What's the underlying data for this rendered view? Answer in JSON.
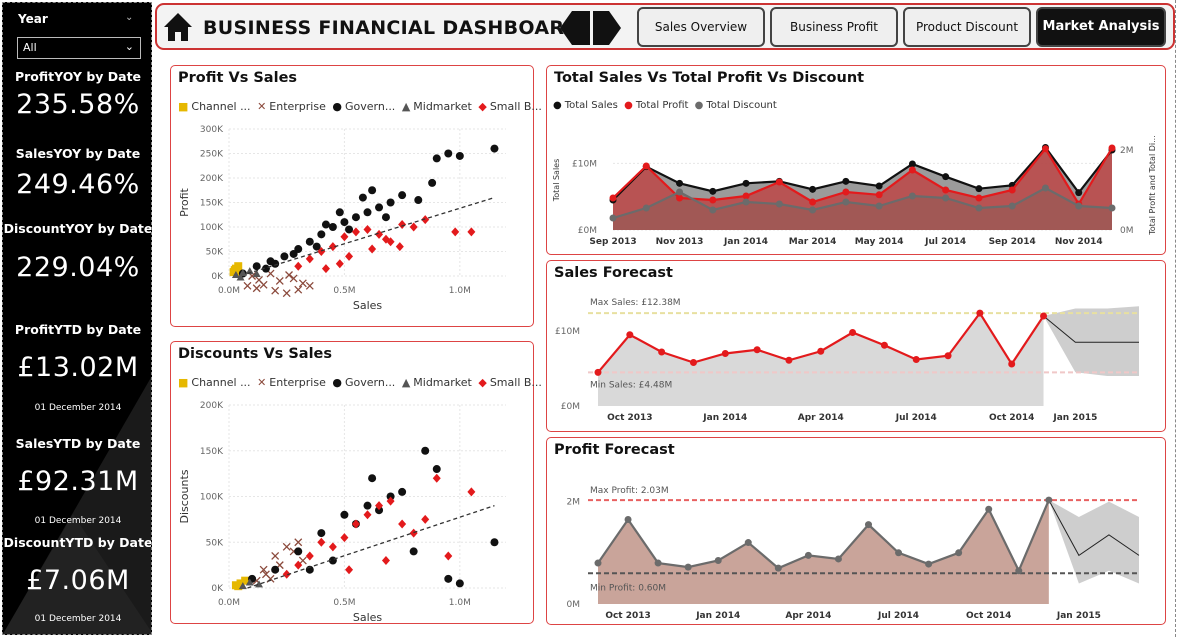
{
  "filter": {
    "label": "Year",
    "value": "All"
  },
  "kpis": [
    {
      "label": "ProfitYOY by Date",
      "value": "235.58%"
    },
    {
      "label": "SalesYOY by Date",
      "value": "249.46%"
    },
    {
      "label": "DiscountYOY by Date",
      "value": "229.04%"
    },
    {
      "label": "ProfitYTD by Date",
      "value": "£13.02M",
      "date": "01 December 2014"
    },
    {
      "label": "SalesYTD by Date",
      "value": "£92.31M",
      "date": "01 December 2014"
    },
    {
      "label": "DiscountYTD by Date",
      "value": "£7.06M",
      "date": "01 December 2014"
    }
  ],
  "header": {
    "title": "BUSINESS FINANCIAL DASHBOARD"
  },
  "tabs": [
    {
      "label": "Sales Overview",
      "active": false
    },
    {
      "label": "Business Profit",
      "active": false
    },
    {
      "label": "Product Discount",
      "active": false
    },
    {
      "label": "Market Analysis",
      "active": true
    }
  ],
  "colors": {
    "red": "#e31a1c",
    "black": "#111111",
    "grey": "#6b6b6b",
    "brown": "#8b4a3c",
    "gold": "#e6b800",
    "panel_border": "#d44444"
  },
  "segments": [
    {
      "name": "Channel ...",
      "marker": "square",
      "color": "#e6b800"
    },
    {
      "name": "Enterprise",
      "marker": "x",
      "color": "#8b4a3c"
    },
    {
      "name": "Govern...",
      "marker": "circle",
      "color": "#111111"
    },
    {
      "name": "Midmarket",
      "marker": "triangle",
      "color": "#555555"
    },
    {
      "name": "Small B...",
      "marker": "diamond",
      "color": "#e31a1c"
    }
  ],
  "chart_data": [
    {
      "type": "scatter",
      "title": "Profit Vs Sales",
      "xlabel": "Sales",
      "ylabel": "Profit",
      "xticks": [
        "0.0M",
        "0.5M",
        "1.0M"
      ],
      "yticks": [
        "0K",
        "50K",
        "100K",
        "150K",
        "200K",
        "250K",
        "300K"
      ],
      "xlim": [
        0,
        1200000
      ],
      "ylim": [
        0,
        300000
      ],
      "trend": [
        [
          80000,
          5000
        ],
        [
          1150000,
          160000
        ]
      ],
      "series": [
        {
          "name": "Channel ...",
          "points": [
            [
              20000,
              8000
            ],
            [
              30000,
              15000
            ],
            [
              40000,
              20000
            ],
            [
              25000,
              12000
            ],
            [
              35000,
              6000
            ]
          ]
        },
        {
          "name": "Enterprise",
          "points": [
            [
              80000,
              -20000
            ],
            [
              120000,
              -25000
            ],
            [
              150000,
              -18000
            ],
            [
              200000,
              -30000
            ],
            [
              250000,
              -35000
            ],
            [
              300000,
              -28000
            ],
            [
              180000,
              5000
            ],
            [
              220000,
              -10000
            ],
            [
              280000,
              -5000
            ],
            [
              320000,
              -15000
            ],
            [
              130000,
              -8000
            ],
            [
              260000,
              2000
            ],
            [
              350000,
              -20000
            ],
            [
              100000,
              0
            ]
          ]
        },
        {
          "name": "Govern...",
          "points": [
            [
              60000,
              5000
            ],
            [
              120000,
              20000
            ],
            [
              180000,
              30000
            ],
            [
              240000,
              40000
            ],
            [
              300000,
              55000
            ],
            [
              350000,
              70000
            ],
            [
              400000,
              85000
            ],
            [
              450000,
              100000
            ],
            [
              500000,
              110000
            ],
            [
              550000,
              120000
            ],
            [
              600000,
              130000
            ],
            [
              650000,
              140000
            ],
            [
              700000,
              150000
            ],
            [
              750000,
              165000
            ],
            [
              580000,
              160000
            ],
            [
              620000,
              175000
            ],
            [
              520000,
              95000
            ],
            [
              480000,
              130000
            ],
            [
              680000,
              120000
            ],
            [
              420000,
              105000
            ],
            [
              380000,
              60000
            ],
            [
              280000,
              45000
            ],
            [
              200000,
              25000
            ],
            [
              160000,
              15000
            ],
            [
              900000,
              240000
            ],
            [
              950000,
              250000
            ],
            [
              1000000,
              245000
            ],
            [
              1150000,
              260000
            ],
            [
              880000,
              190000
            ],
            [
              820000,
              155000
            ]
          ]
        },
        {
          "name": "Midmarket",
          "points": [
            [
              30000,
              2000
            ],
            [
              60000,
              6000
            ],
            [
              90000,
              10000
            ],
            [
              50000,
              -3000
            ],
            [
              120000,
              4000
            ]
          ]
        },
        {
          "name": "Small B...",
          "points": [
            [
              300000,
              20000
            ],
            [
              350000,
              35000
            ],
            [
              400000,
              50000
            ],
            [
              450000,
              60000
            ],
            [
              500000,
              80000
            ],
            [
              550000,
              90000
            ],
            [
              600000,
              95000
            ],
            [
              650000,
              85000
            ],
            [
              700000,
              70000
            ],
            [
              750000,
              105000
            ],
            [
              800000,
              100000
            ],
            [
              850000,
              115000
            ],
            [
              980000,
              90000
            ],
            [
              1050000,
              90000
            ],
            [
              420000,
              15000
            ],
            [
              520000,
              40000
            ],
            [
              620000,
              55000
            ],
            [
              680000,
              75000
            ],
            [
              740000,
              60000
            ],
            [
              480000,
              25000
            ]
          ]
        }
      ]
    },
    {
      "type": "scatter",
      "title": "Discounts Vs Sales",
      "xlabel": "Sales",
      "ylabel": "Discounts",
      "xticks": [
        "0.0M",
        "0.5M",
        "1.0M"
      ],
      "yticks": [
        "0K",
        "50K",
        "100K",
        "150K",
        "200K"
      ],
      "xlim": [
        0,
        1200000
      ],
      "ylim": [
        0,
        200000
      ],
      "trend": [
        [
          80000,
          0
        ],
        [
          1150000,
          90000
        ]
      ],
      "series": [
        {
          "name": "Channel ...",
          "points": [
            [
              30000,
              3000
            ],
            [
              50000,
              5000
            ],
            [
              70000,
              8000
            ],
            [
              40000,
              2000
            ]
          ]
        },
        {
          "name": "Enterprise",
          "points": [
            [
              150000,
              20000
            ],
            [
              200000,
              35000
            ],
            [
              250000,
              45000
            ],
            [
              300000,
              50000
            ],
            [
              180000,
              10000
            ],
            [
              220000,
              25000
            ],
            [
              120000,
              8000
            ],
            [
              280000,
              40000
            ],
            [
              320000,
              30000
            ],
            [
              160000,
              15000
            ]
          ]
        },
        {
          "name": "Govern...",
          "points": [
            [
              100000,
              10000
            ],
            [
              200000,
              20000
            ],
            [
              300000,
              40000
            ],
            [
              400000,
              60000
            ],
            [
              500000,
              80000
            ],
            [
              600000,
              90000
            ],
            [
              700000,
              100000
            ],
            [
              850000,
              150000
            ],
            [
              900000,
              130000
            ],
            [
              1150000,
              50000
            ],
            [
              950000,
              10000
            ],
            [
              800000,
              40000
            ],
            [
              550000,
              70000
            ],
            [
              650000,
              85000
            ],
            [
              450000,
              30000
            ],
            [
              350000,
              20000
            ],
            [
              750000,
              105000
            ],
            [
              1000000,
              5000
            ],
            [
              620000,
              120000
            ]
          ]
        },
        {
          "name": "Midmarket",
          "points": [
            [
              60000,
              2000
            ],
            [
              90000,
              6000
            ],
            [
              130000,
              4000
            ]
          ]
        },
        {
          "name": "Small B...",
          "points": [
            [
              250000,
              15000
            ],
            [
              300000,
              25000
            ],
            [
              350000,
              35000
            ],
            [
              400000,
              50000
            ],
            [
              450000,
              45000
            ],
            [
              500000,
              55000
            ],
            [
              550000,
              70000
            ],
            [
              600000,
              80000
            ],
            [
              650000,
              90000
            ],
            [
              700000,
              95000
            ],
            [
              750000,
              70000
            ],
            [
              800000,
              60000
            ],
            [
              850000,
              75000
            ],
            [
              900000,
              120000
            ],
            [
              1050000,
              105000
            ],
            [
              950000,
              35000
            ],
            [
              680000,
              30000
            ],
            [
              520000,
              20000
            ]
          ]
        }
      ]
    },
    {
      "type": "area",
      "title": "Total Sales Vs Total Profit Vs Discount",
      "ylabel": "Total Sales",
      "y2label": "Total Profit and Total Di...",
      "categories": [
        "Sep 2013",
        "Oct 2013",
        "Nov 2013",
        "Dec 2013",
        "Jan 2014",
        "Feb 2014",
        "Mar 2014",
        "Apr 2014",
        "May 2014",
        "Jun 2014",
        "Jul 2014",
        "Aug 2014",
        "Sep 2014",
        "Oct 2014",
        "Nov 2014",
        "Dec 2014"
      ],
      "xticks": [
        "Sep 2013",
        "Nov 2013",
        "Jan 2014",
        "Mar 2014",
        "May 2014",
        "Jul 2014",
        "Sep 2014",
        "Nov 2014"
      ],
      "yticks": [
        "£0M",
        "£10M"
      ],
      "y2ticks": [
        "0M",
        "2M"
      ],
      "ylim": [
        0,
        15000000
      ],
      "y2lim": [
        0,
        2500000
      ],
      "series": [
        {
          "name": "Total Sales",
          "axis": "left",
          "values": [
            4500000,
            9500000,
            7000000,
            5800000,
            7000000,
            7300000,
            6100000,
            7300000,
            6600000,
            9900000,
            8000000,
            6200000,
            6700000,
            12380000,
            5600000,
            12000000
          ]
        },
        {
          "name": "Total Profit",
          "axis": "right",
          "values": [
            800000,
            1600000,
            800000,
            750000,
            850000,
            1200000,
            700000,
            950000,
            880000,
            1500000,
            1000000,
            800000,
            1000000,
            2030000,
            650000,
            2050000
          ]
        },
        {
          "name": "Total Discount",
          "axis": "right",
          "values": [
            300000,
            550000,
            950000,
            500000,
            700000,
            650000,
            500000,
            700000,
            600000,
            850000,
            800000,
            550000,
            600000,
            1050000,
            600000,
            550000
          ]
        }
      ]
    },
    {
      "type": "line",
      "title": "Sales Forecast",
      "categories": [
        "Sep 2013",
        "Oct 2013",
        "Nov 2013",
        "Dec 2013",
        "Jan 2014",
        "Feb 2014",
        "Mar 2014",
        "Apr 2014",
        "May 2014",
        "Jun 2014",
        "Jul 2014",
        "Aug 2014",
        "Sep 2014",
        "Oct 2014",
        "Nov 2014",
        "Dec 2014"
      ],
      "xticks": [
        "Oct 2013",
        "Jan 2014",
        "Apr 2014",
        "Jul 2014",
        "Oct 2014",
        "Jan 2015"
      ],
      "yticks": [
        "£0M",
        "£10M"
      ],
      "ylim": [
        0,
        14000000
      ],
      "values": [
        4480000,
        9500000,
        7200000,
        5800000,
        7000000,
        7500000,
        6100000,
        7300000,
        9800000,
        8100000,
        6200000,
        6700000,
        12380000,
        5600000,
        12000000
      ],
      "forecast": {
        "mean": [
          12000000,
          8500000,
          8500000,
          8500000
        ],
        "upper": [
          12000000,
          13000000,
          13000000,
          13300000
        ],
        "lower": [
          12000000,
          4500000,
          4000000,
          4000000
        ]
      },
      "ref_lines": [
        {
          "label": "Max Sales: £12.38M",
          "value": 12380000,
          "color": "#e8e0a0"
        },
        {
          "label": "Min Sales: £4.48M",
          "value": 4480000,
          "color": "#f0c8c8"
        }
      ]
    },
    {
      "type": "line",
      "title": "Profit Forecast",
      "categories": [
        "Sep 2013",
        "Oct 2013",
        "Nov 2013",
        "Dec 2013",
        "Jan 2014",
        "Feb 2014",
        "Mar 2014",
        "Apr 2014",
        "May 2014",
        "Jun 2014",
        "Jul 2014",
        "Aug 2014",
        "Sep 2014",
        "Oct 2014",
        "Nov 2014",
        "Dec 2014"
      ],
      "xticks": [
        "Oct 2013",
        "Jan 2014",
        "Apr 2014",
        "Jul 2014",
        "Oct 2014",
        "Jan 2015"
      ],
      "yticks": [
        "0M",
        "2M"
      ],
      "ylim": [
        0,
        2500000
      ],
      "values": [
        800000,
        1650000,
        800000,
        720000,
        850000,
        1200000,
        700000,
        950000,
        880000,
        1550000,
        1000000,
        780000,
        1000000,
        1850000,
        650000,
        2030000
      ],
      "forecast": {
        "mean": [
          2030000,
          950000,
          1350000,
          950000
        ],
        "upper": [
          2030000,
          1700000,
          2000000,
          1700000
        ],
        "lower": [
          2030000,
          400000,
          650000,
          400000
        ]
      },
      "ref_lines": [
        {
          "label": "Max Profit: 2.03M",
          "value": 2030000,
          "color": "#e86060"
        },
        {
          "label": "Min Profit: 0.60M",
          "value": 600000,
          "color": "#555555"
        }
      ]
    }
  ]
}
